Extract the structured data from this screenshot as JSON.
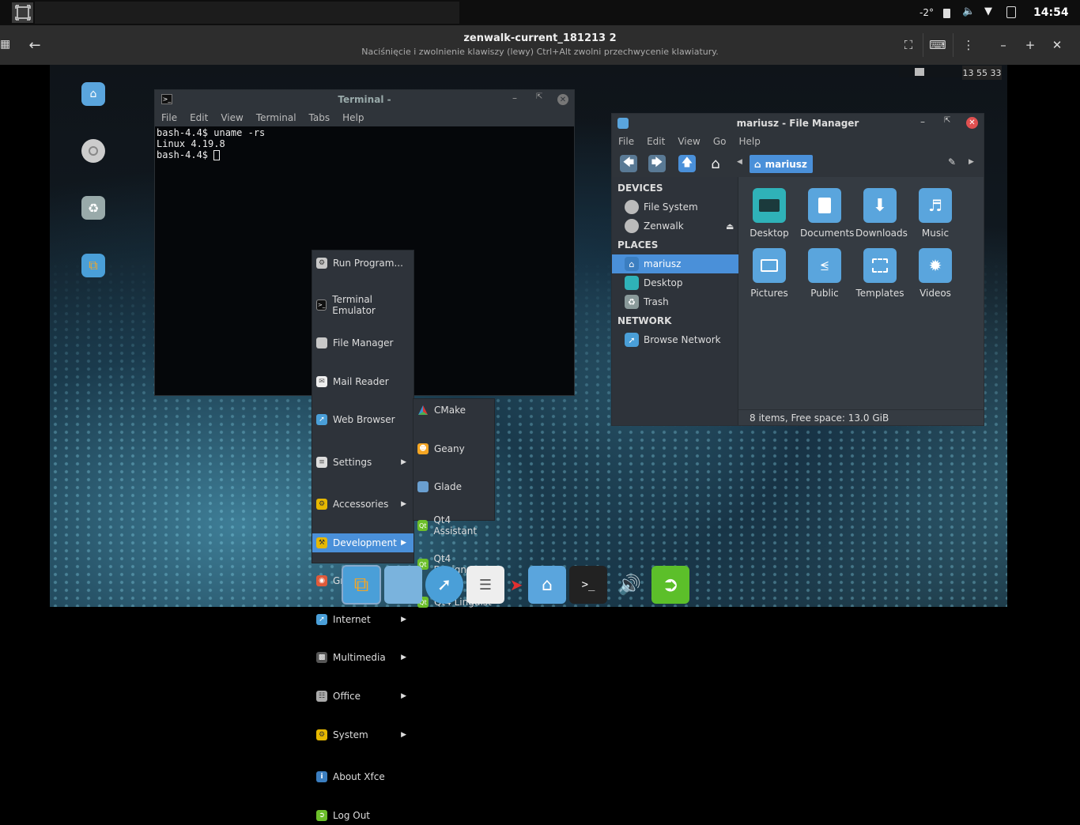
{
  "host": {
    "temperature": "-2°",
    "time": "14:54"
  },
  "viewer": {
    "title": "zenwalk-current_181213 2",
    "subtitle": "Naciśnięcie i zwolnienie klawiszy (lewy) Ctrl+Alt zwolni przechwycenie klawiatury."
  },
  "guest": {
    "clock": "13 55 33"
  },
  "terminal": {
    "title": "Terminal -",
    "menu": [
      "File",
      "Edit",
      "View",
      "Terminal",
      "Tabs",
      "Help"
    ],
    "lines": [
      "bash-4.4$ uname -rs",
      "Linux 4.19.8",
      "bash-4.4$ "
    ]
  },
  "file_manager": {
    "title": "mariusz - File Manager",
    "menu": [
      "File",
      "Edit",
      "View",
      "Go",
      "Help"
    ],
    "path": "mariusz",
    "devices_header": "DEVICES",
    "devices": [
      "File System",
      "Zenwalk"
    ],
    "places_header": "PLACES",
    "places": [
      "mariusz",
      "Desktop",
      "Trash"
    ],
    "network_header": "NETWORK",
    "network": [
      "Browse Network"
    ],
    "folders": [
      "Desktop",
      "Documents",
      "Downloads",
      "Music",
      "Pictures",
      "Public",
      "Templates",
      "Videos"
    ],
    "status": "8 items, Free space: 13.0 GiB"
  },
  "app_menu": {
    "run": "Run Program...",
    "terminal": "Terminal Emulator",
    "file_manager": "File Manager",
    "mail": "Mail Reader",
    "web": "Web Browser",
    "settings": "Settings",
    "accessories": "Accessories",
    "development": "Development",
    "graphics": "Graphics",
    "internet": "Internet",
    "multimedia": "Multimedia",
    "office": "Office",
    "system": "System",
    "about": "About Xfce",
    "logout": "Log Out"
  },
  "dev_submenu": {
    "cmake": "CMake",
    "geany": "Geany",
    "glade": "Glade",
    "qt_assistant": "Qt4 Assistant",
    "qt_designer": "Qt4 Designer",
    "qt_linguist": "Qt4 Linguist",
    "qt_badge": "Qt"
  }
}
